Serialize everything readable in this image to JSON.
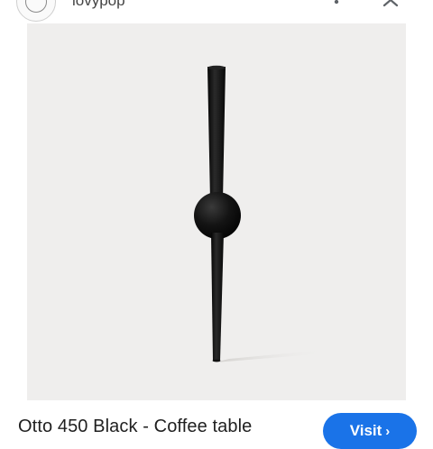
{
  "header": {
    "site_name": "lovypop"
  },
  "product": {
    "image_alt": "Otto 450 Black coffee table leg",
    "title": "Otto 450 Black - Coffee table",
    "visit_label": "Visit",
    "visit_icon": "chevron-right-icon"
  },
  "colors": {
    "accent": "#1a73e8",
    "photo_background": "#efeeed",
    "leg": "#0d0d0d"
  }
}
